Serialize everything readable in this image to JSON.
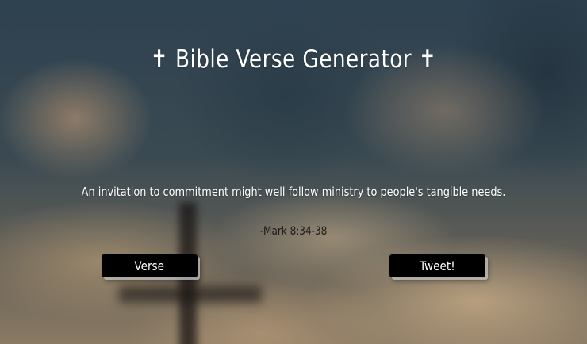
{
  "header": {
    "title": "✝ Bible Verse Generator ✝"
  },
  "quote": {
    "text": "An invitation to commitment might well follow ministry to people's tangible needs.",
    "reference": "-Mark 8:34-38"
  },
  "actions": {
    "verse_label": "Verse",
    "tweet_label": "Tweet!"
  },
  "colors": {
    "button_bg": "#000000",
    "button_text": "#ffffff",
    "title_text": "#ffffff",
    "reference_text": "#1a1a1a"
  }
}
